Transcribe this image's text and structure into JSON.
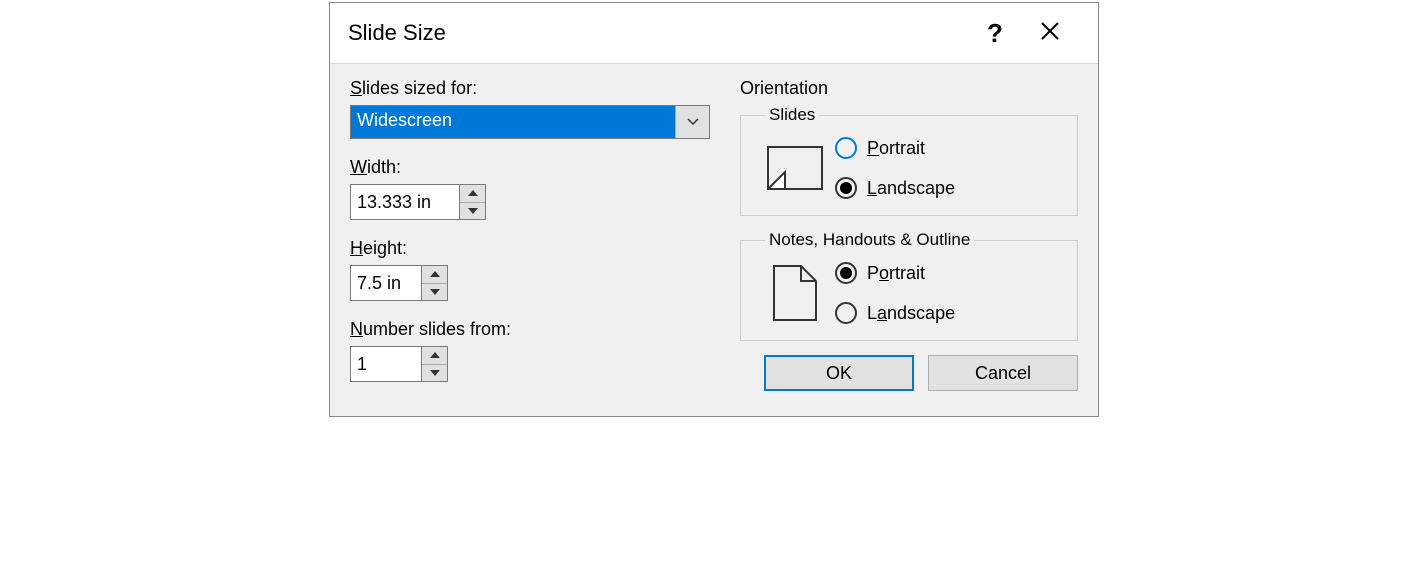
{
  "title": "Slide Size",
  "labels": {
    "sized_for": "Slides sized for:",
    "width": "Width:",
    "height": "Height:",
    "number_from": "Number slides from:",
    "orientation": "Orientation",
    "slides": "Slides",
    "notes": "Notes, Handouts & Outline",
    "portrait": "Portrait",
    "landscape": "Landscape"
  },
  "values": {
    "sized_for": "Widescreen",
    "width": "13.333 in",
    "height": "7.5 in",
    "number_from": "1"
  },
  "orientation": {
    "slides": "landscape",
    "notes": "portrait"
  },
  "buttons": {
    "ok": "OK",
    "cancel": "Cancel"
  }
}
